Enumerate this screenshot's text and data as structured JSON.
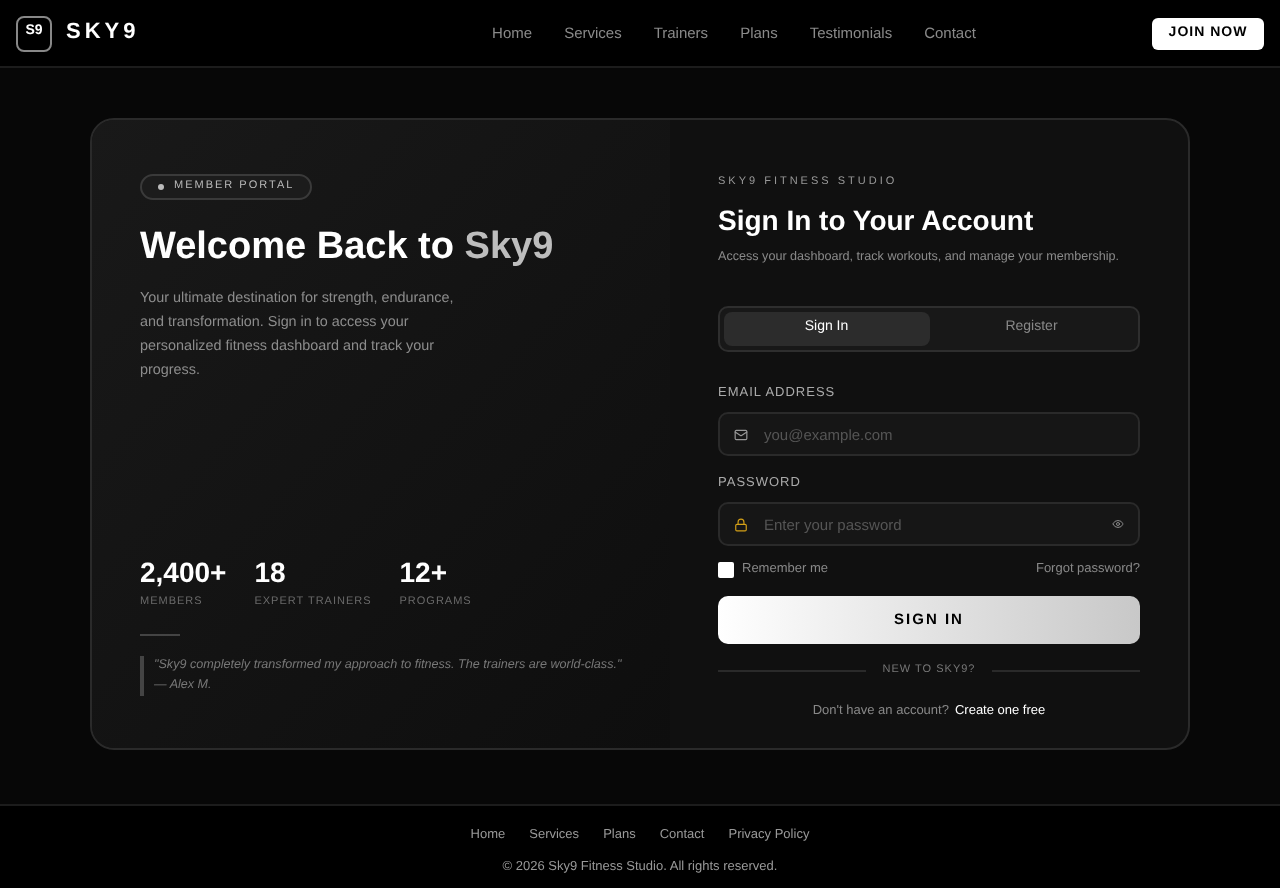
{
  "header": {
    "logo_mark": "S9",
    "brand": "SKY9",
    "nav": [
      {
        "label": "Home"
      },
      {
        "label": "Services"
      },
      {
        "label": "Trainers"
      },
      {
        "label": "Plans"
      },
      {
        "label": "Testimonials"
      },
      {
        "label": "Contact"
      }
    ],
    "cta": "JOIN NOW"
  },
  "hero": {
    "badge": "MEMBER PORTAL",
    "title": "Welcome Back to",
    "title_accent": "Sky9",
    "description": "Your ultimate destination for strength, endurance, and transformation. Sign in to access your personalized fitness dashboard and track your progress.",
    "stats": [
      {
        "value": "2,400+",
        "label": "MEMBERS"
      },
      {
        "value": "18",
        "label": "EXPERT TRAINERS"
      },
      {
        "value": "12+",
        "label": "PROGRAMS"
      }
    ],
    "quote": "\"Sky9 completely transformed my approach to fitness. The trainers are world-class.\" — Alex M."
  },
  "form": {
    "eyebrow": "SKY9 FITNESS STUDIO",
    "title": "Sign In to Your Account",
    "subtitle": "Access your dashboard, track workouts, and manage your membership.",
    "tabs": [
      {
        "label": "Sign In",
        "selected": true
      },
      {
        "label": "Register",
        "selected": false
      }
    ],
    "email": {
      "label": "EMAIL ADDRESS",
      "placeholder": "you@example.com"
    },
    "password": {
      "label": "PASSWORD",
      "placeholder": "Enter your password"
    },
    "remember": {
      "label": "Remember me",
      "checked": false
    },
    "forgot": "Forgot password?",
    "submit": "SIGN IN",
    "divider": "NEW TO SKY9?",
    "signup_prompt": "Don't have an account?",
    "signup_link": "Create one free"
  },
  "footer": {
    "links": [
      {
        "label": "Home"
      },
      {
        "label": "Services"
      },
      {
        "label": "Plans"
      },
      {
        "label": "Contact"
      },
      {
        "label": "Privacy Policy"
      }
    ],
    "copyright": "© 2026 Sky9 Fitness Studio. All rights reserved."
  }
}
